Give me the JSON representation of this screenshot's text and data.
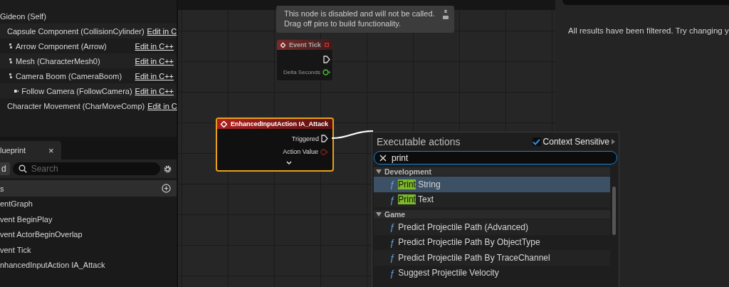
{
  "components": [
    {
      "label": "Gideon (Self)",
      "children": [
        {
          "label": "Capsule Component (CollisionCylinder)",
          "link": "Edit in C",
          "children": [
            {
              "label": "Arrow Component (Arrow)",
              "link": "Edit in C++",
              "kind": "component"
            },
            {
              "label": "Mesh (CharacterMesh0)",
              "link": "Edit in C++",
              "kind": "component"
            },
            {
              "label": "Camera Boom (CameraBoom)",
              "link": "Edit in C++",
              "kind": "component",
              "children": [
                {
                  "label": "Follow Camera (FollowCamera)",
                  "link": "Edit in C++",
                  "kind": "camera"
                }
              ]
            }
          ]
        },
        {
          "label": "Character Movement (CharMoveComp)",
          "link": "Edit in C"
        }
      ]
    }
  ],
  "my_blueprint": {
    "tab": {
      "label": "lueprint",
      "close": "×",
      "selected": true
    },
    "add_button": "d",
    "search": {
      "placeholder": "Search"
    },
    "section": "s",
    "items": [
      {
        "label": "entGraph"
      },
      {
        "label": "vent BeginPlay"
      },
      {
        "label": "vent ActorBeginOverlap"
      },
      {
        "label": "vent Tick"
      },
      {
        "label": "nhancedInputAction IA_Attack"
      }
    ]
  },
  "graph": {
    "tooltip": "This node is disabled and will not be called.\nDrag off pins to build functionality.",
    "nodes": [
      {
        "title": "Event Tick",
        "disabled": true,
        "selected": false,
        "pins": [
          {
            "kind": "exec"
          },
          {
            "kind": "data",
            "label": "Delta Seconds",
            "color": "#4cb036"
          }
        ]
      },
      {
        "title": "EnhancedInputAction IA_Attack",
        "disabled": false,
        "selected": true,
        "pins": [
          {
            "kind": "exec",
            "label": "Triggered"
          },
          {
            "kind": "data",
            "label": "Action Value",
            "color": "#7a1c1c"
          }
        ]
      }
    ]
  },
  "action_menu": {
    "title": "Executable actions",
    "context_sensitive": {
      "label": "Context Sensitive",
      "checked": true
    },
    "search": {
      "value": "print"
    },
    "categories": [
      {
        "label": "Development",
        "items": [
          {
            "icon": "ƒ",
            "highlight": "Print",
            "text": " String",
            "selected": true
          },
          {
            "icon": "ƒ",
            "highlight": "Print",
            "text": " Text",
            "selected": false
          }
        ]
      },
      {
        "label": "Game",
        "items": [
          {
            "icon": "ƒ",
            "text": "Predict Projectile Path (Advanced)",
            "selected": false
          },
          {
            "icon": "ƒ",
            "text": "Predict Projectile Path By ObjectType",
            "selected": false
          },
          {
            "icon": "ƒ",
            "text": "Predict Projectile Path By TraceChannel",
            "selected": false
          },
          {
            "icon": "ƒ",
            "text": "Suggest Projectile Velocity",
            "selected": false
          }
        ]
      }
    ]
  },
  "find_results": {
    "message": "All results have been filtered. Try changing y"
  }
}
